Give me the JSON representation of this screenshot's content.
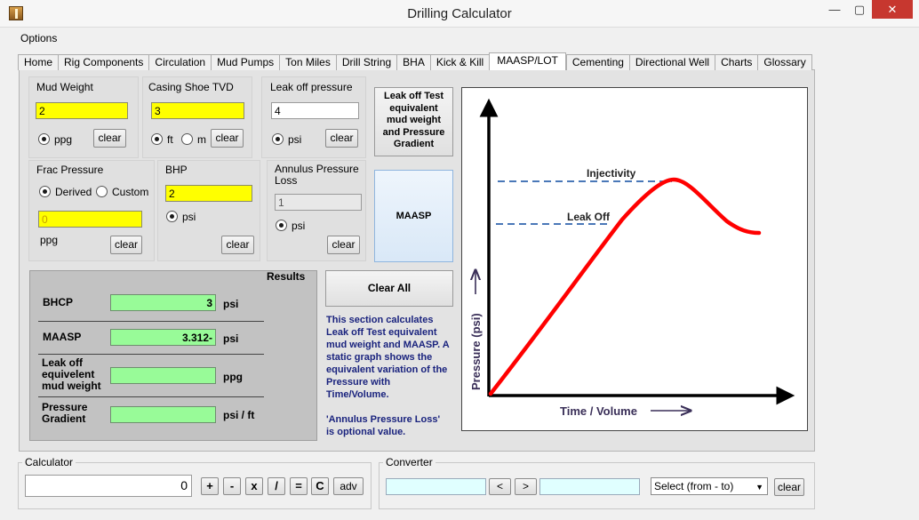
{
  "window": {
    "title": "Drilling Calculator",
    "min_glyph": "—",
    "max_glyph": "▢",
    "close_glyph": "✕"
  },
  "menu": {
    "options": "Options"
  },
  "tabs": [
    "Home",
    "Rig Components",
    "Circulation",
    "Mud Pumps",
    "Ton Miles",
    "Drill String",
    "BHA",
    "Kick & Kill",
    "MAASP/LOT",
    "Cementing",
    "Directional Well",
    "Charts",
    "Glossary"
  ],
  "active_tab": "MAASP/LOT",
  "inputs": {
    "mud_weight": {
      "label": "Mud Weight",
      "value": "2",
      "unit_option": "ppg",
      "clear": "clear"
    },
    "casing_shoe_tvd": {
      "label": "Casing Shoe TVD",
      "value": "3",
      "unit_ft": "ft",
      "unit_m": "m",
      "clear": "clear"
    },
    "leak_off_pressure": {
      "label": "Leak off pressure",
      "value": "4",
      "unit_option": "psi",
      "clear": "clear"
    },
    "frac_pressure": {
      "label": "Frac Pressure",
      "derived": "Derived",
      "custom": "Custom",
      "value": "0",
      "unit": "ppg",
      "clear": "clear"
    },
    "bhp": {
      "label": "BHP",
      "value": "2",
      "unit_option": "psi",
      "clear": "clear"
    },
    "annulus_pressure_loss": {
      "label_line1": "Annulus Pressure",
      "label_line2": "Loss",
      "value": "1",
      "unit_option": "psi",
      "clear": "clear"
    }
  },
  "buttons": {
    "lot_emw": {
      "l1": "Leak off Test",
      "l2": "equivalent",
      "l3": "mud weight",
      "l4": "and Pressure",
      "l5": "Gradient"
    },
    "maasp": "MAASP",
    "clear_all": "Clear All"
  },
  "results": {
    "title": "Results",
    "bhcp": {
      "label": "BHCP",
      "value": "3",
      "unit": "psi"
    },
    "maasp": {
      "label": "MAASP",
      "value": "3.312-",
      "unit": "psi"
    },
    "lot_emw": {
      "l1": "Leak off",
      "l2": "equivelent",
      "l3": "mud weight",
      "value": "",
      "unit": "ppg"
    },
    "gradient": {
      "l1": "Pressure",
      "l2": "Gradient",
      "value": "",
      "unit": "psi / ft"
    }
  },
  "info": {
    "p1": "This section calculates Leak off Test equivalent mud weight and MAASP. A static graph shows the equivalent variation of the Pressure with Time/Volume.",
    "p2": "'Annulus Pressure Loss' is optional value."
  },
  "graph": {
    "ylabel": "Pressure (psi)",
    "xlabel": "Time / Volume",
    "injectivity": "Injectivity",
    "leak_off": "Leak Off",
    "curve_color": "#ff0000",
    "dash_color": "#4a78b8"
  },
  "calculator": {
    "legend": "Calculator",
    "display": "0",
    "plus": "+",
    "minus": "-",
    "times": "x",
    "divide": "/",
    "equals": "=",
    "clear": "C",
    "adv": "adv"
  },
  "converter": {
    "legend": "Converter",
    "from_value": "",
    "to_value": "",
    "prev": "<",
    "next": ">",
    "select": "Select (from - to)",
    "clear": "clear"
  }
}
